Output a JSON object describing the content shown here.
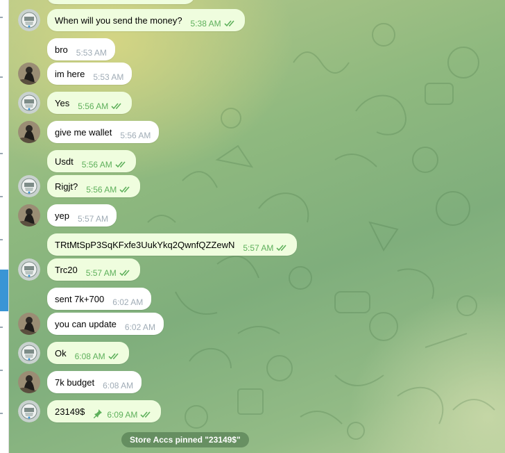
{
  "colors": {
    "incoming": "#ffffff",
    "outgoing": "#effdde",
    "check": "#5eb05b",
    "sidebar_selected": "#3a95d5"
  },
  "messages": [
    {
      "text": "When will you send the money?",
      "time": "5:38 AM",
      "dir": "out",
      "status": "read"
    },
    {
      "text": "bro",
      "time": "5:53 AM",
      "dir": "in"
    },
    {
      "text": "im here",
      "time": "5:53 AM",
      "dir": "in"
    },
    {
      "text": "Yes",
      "time": "5:56 AM",
      "dir": "out",
      "status": "read"
    },
    {
      "text": "give me wallet",
      "time": "5:56 AM",
      "dir": "in"
    },
    {
      "text": "Usdt",
      "time": "5:56 AM",
      "dir": "out",
      "status": "read"
    },
    {
      "text": "Rigjt?",
      "time": "5:56 AM",
      "dir": "out",
      "status": "read"
    },
    {
      "text": "yep",
      "time": "5:57 AM",
      "dir": "in"
    },
    {
      "text": "TRtMtSpP3SqKFxfe3UukYkq2QwnfQZZewN",
      "time": "5:57 AM",
      "dir": "out",
      "status": "read"
    },
    {
      "text": "Trc20",
      "time": "5:57 AM",
      "dir": "out",
      "status": "read"
    },
    {
      "text": "sent 7k+700",
      "time": "6:02 AM",
      "dir": "in"
    },
    {
      "text": "you can update",
      "time": "6:02 AM",
      "dir": "in"
    },
    {
      "text": "Ok",
      "time": "6:08 AM",
      "dir": "out",
      "status": "read"
    },
    {
      "text": "7k budget",
      "time": "6:08 AM",
      "dir": "in"
    },
    {
      "text": "23149$",
      "time": "6:09 AM",
      "dir": "out",
      "status": "read",
      "pinned": true
    }
  ],
  "pinned_notice": "Store Accs pinned \"23149$\""
}
